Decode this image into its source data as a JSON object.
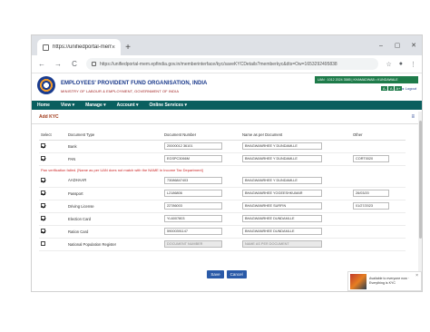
{
  "browser": {
    "tab_title": "https://unifiedportal-mem.e",
    "tab_close": "×",
    "new_tab": "+",
    "win_min": "–",
    "win_max": "▢",
    "win_close": "✕",
    "back": "←",
    "forward": "→",
    "reload": "C",
    "url": "https://unifiedportal-mem.epfindia.gov.in/memberinterface/kyc/saveKYCDetails?memberkyc&dts=Ow=1653292495838",
    "star_icon": "☆",
    "profile_icon": "●",
    "menu_icon": "⋮"
  },
  "site": {
    "org_name": "EMPLOYEES' PROVIDENT FUND ORGANISATION, INDIA",
    "org_sub": "MINISTRY OF LABOUR & EMPLOYMENT, GOVERNMENT OF INDIA",
    "uan_text": "UAN : 1012 2024 3585 | KHAMADWAB • KUNDAWALE",
    "font_buttons": [
      "A-",
      "A",
      "A+"
    ],
    "logout": "▸ Logout",
    "nav": [
      "Home",
      "View ▾",
      "Manage ▾",
      "Account ▾",
      "Online Services ▾"
    ]
  },
  "page": {
    "title": "Add KYC",
    "menu_icon": "≡",
    "columns": [
      "Select",
      "Document Type",
      "Document Number",
      "Name as per Document",
      "Other"
    ],
    "rows": [
      {
        "checked": true,
        "type": "Bank",
        "number": "20000012 36101",
        "name": "BHAGWANRHEE Y DUNDAMLLE",
        "other": "",
        "disabled": false
      },
      {
        "checked": true,
        "type": "PAN",
        "number": "EGSPC3066M",
        "name": "BHAGWANRHEE Y DUNDAMLLE",
        "other": "CORT0020",
        "disabled": false
      },
      {
        "checked": true,
        "type": "AADHAAR",
        "number": "73086847403",
        "name": "BHAGWANRHEE Y DUNDAMLLE",
        "other": "",
        "disabled": false
      },
      {
        "checked": true,
        "type": "Passport",
        "number": "L2186806",
        "name": "BHAGWANRHEE YOGEESHKUMAR",
        "other": "26/03/20",
        "disabled": false
      },
      {
        "checked": true,
        "type": "Driving License",
        "number": "22786003",
        "name": "BHAGWANRHEE SURFIN",
        "other": "01/27/2023",
        "disabled": false
      },
      {
        "checked": true,
        "type": "Election Card",
        "number": "YL6007803",
        "name": "BHAGWANRHEE DUNDAMLLE",
        "other": "",
        "disabled": false
      },
      {
        "checked": true,
        "type": "Ration Card",
        "number": "59000391147",
        "name": "BHAGWANRHEE DUNDAMLLE",
        "other": "",
        "disabled": false
      },
      {
        "checked": false,
        "type": "National Population Register",
        "number": "DOCUMENT NUMBER",
        "name": "NAME AS PER DOCUMENT",
        "other": "",
        "disabled": true
      }
    ],
    "error_text": "Pan verification failed. [Name as per UAN does not match with the NAME in Income Tax Department]",
    "save_label": "Save",
    "cancel_label": "Cancel"
  },
  "toast": {
    "text": "Available to everyone now · Everything is KYC",
    "close": "×"
  }
}
